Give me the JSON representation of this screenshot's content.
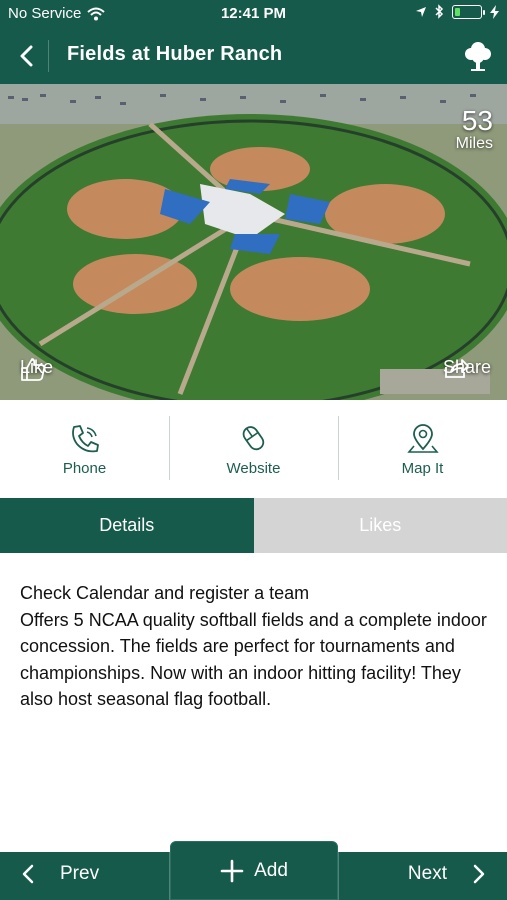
{
  "status_bar": {
    "carrier": "No Service",
    "time": "12:41 PM",
    "battery_level": 0.2
  },
  "nav": {
    "title": "Fields at Huber Ranch",
    "back_icon": "chevron-left-icon",
    "right_icon": "tree-icon"
  },
  "hero": {
    "distance_value": "53",
    "distance_unit": "Miles",
    "like_label": "Like",
    "share_label": "Share"
  },
  "actions": [
    {
      "label": "Phone",
      "icon": "phone-icon"
    },
    {
      "label": "Website",
      "icon": "mouse-icon"
    },
    {
      "label": "Map It",
      "icon": "map-pin-icon"
    }
  ],
  "tabs": {
    "details": "Details",
    "likes": "Likes"
  },
  "description": {
    "line1": "Check Calendar and register a team",
    "body": "Offers 5 NCAA quality softball fields and a complete indoor concession. The fields are perfect for tournaments and championships. Now with an indoor hitting facility! They also host seasonal flag football."
  },
  "bottom_bar": {
    "prev_label": "Prev",
    "add_label": "Add",
    "next_label": "Next"
  },
  "colors": {
    "brand_green": "#155a4b",
    "inactive_tab": "#d4d4d4"
  }
}
